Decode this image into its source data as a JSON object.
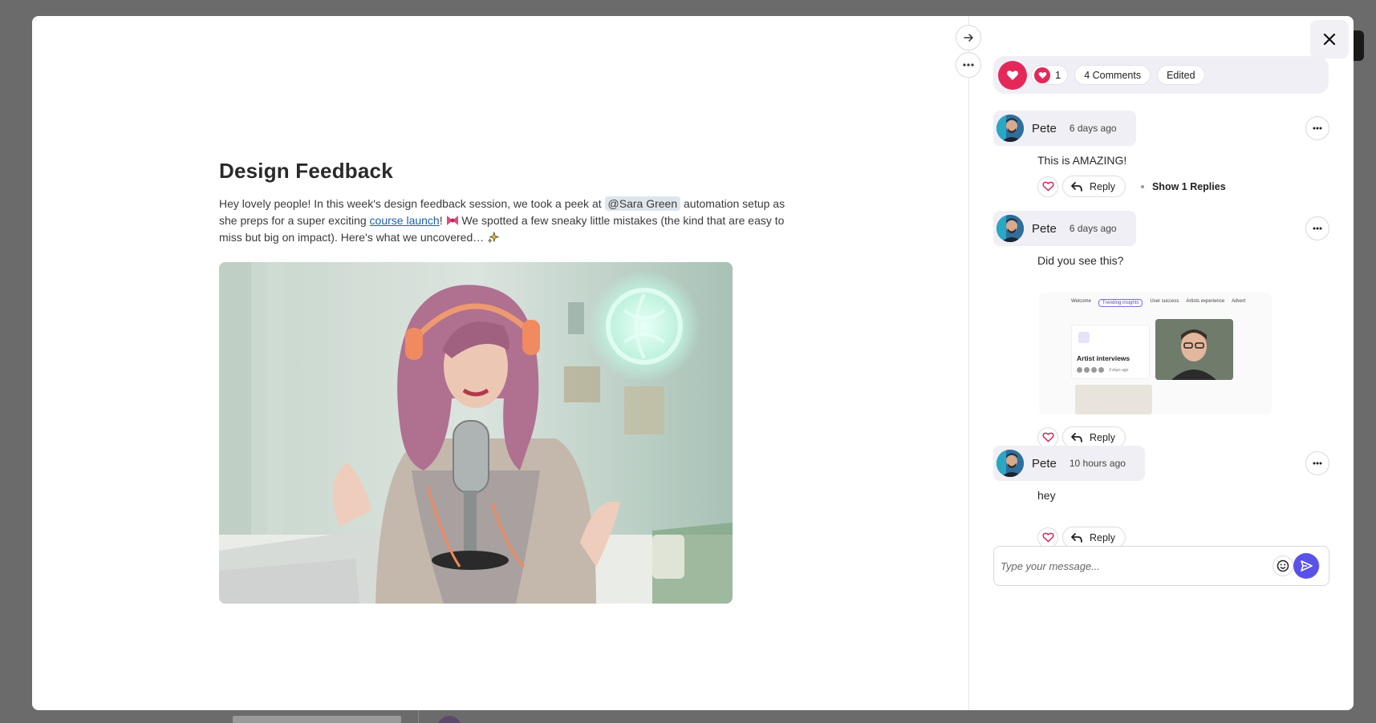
{
  "post": {
    "title": "Design Feedback",
    "intro": "Hey lovely people! In this week's design feedback session, we took a peek at ",
    "mention": "@Sara Green",
    "mid": " automation setup as she preps for a super exciting ",
    "link": "course launch",
    "after_link": "! ",
    "mid2": " We spotted a few sneaky little mistakes (the kind that are easy to miss but big on impact). Here's what we uncovered… "
  },
  "reactions": {
    "like_count": "1",
    "comments_label": "4 Comments",
    "edited_label": "Edited"
  },
  "comments": [
    {
      "author": "Pete",
      "time": "6 days ago",
      "text": "This is AMAZING!",
      "reply_label": "Reply",
      "show_replies": "Show 1 Replies"
    },
    {
      "author": "Pete",
      "time": "6 days ago",
      "text": "Did you see this?",
      "reply_label": "Reply"
    },
    {
      "author": "Pete",
      "time": "10 hours ago",
      "text": "hey",
      "reply_label": "Reply"
    }
  ],
  "attachment": {
    "tabs": [
      "Welcome",
      "Trending insights",
      "User success",
      "Artists experience",
      "Advert"
    ],
    "card_title": "Artist interviews",
    "card_meta": "3 days ago"
  },
  "composer": {
    "placeholder": "Type your message..."
  },
  "colors": {
    "accent_red": "#e4285a",
    "send_blue": "#5a52e8",
    "link_blue": "#1d5fb0"
  }
}
